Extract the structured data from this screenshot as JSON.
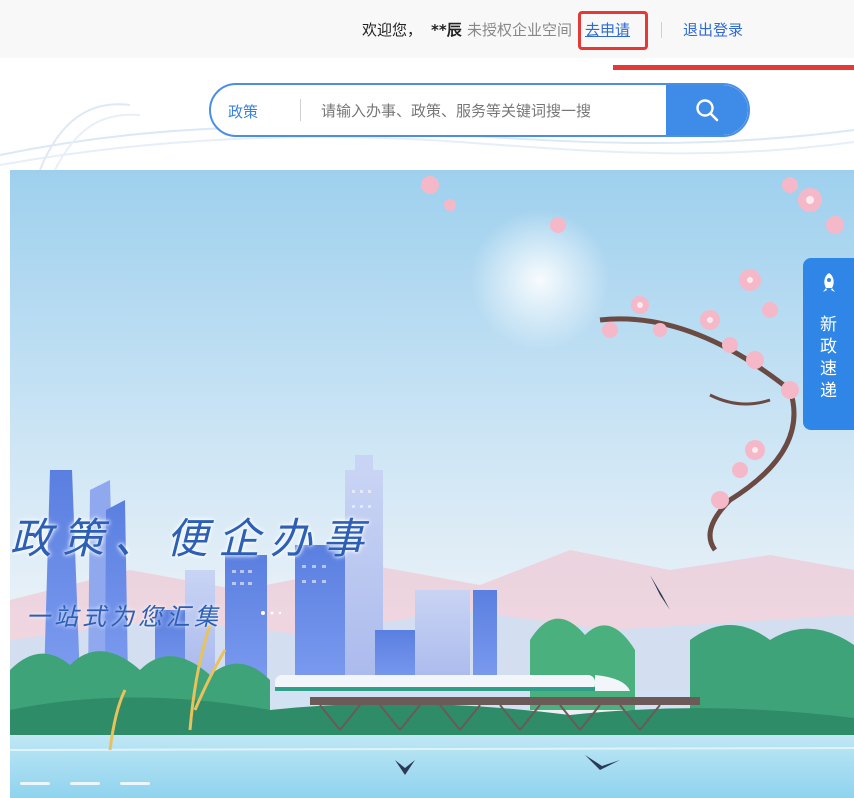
{
  "header": {
    "welcome": "欢迎您，",
    "username": "**辰",
    "unauthorized_text": "未授权企业空间",
    "apply_link": "去申请",
    "logout_link": "退出登录"
  },
  "search": {
    "category": "政策",
    "placeholder": "请输入办事、政策、服务等关键词搜一搜",
    "button_icon": "search-icon"
  },
  "banner": {
    "slogan_main": "政策、便企办事",
    "slogan_sub": "一站式为您汇集"
  },
  "side_tab": {
    "icon": "rocket-icon",
    "label": "新政速递"
  },
  "colors": {
    "accent": "#3f8ce8",
    "link": "#2e6ad6",
    "highlight_red": "#e53935",
    "sky": "#cfe6f5"
  }
}
